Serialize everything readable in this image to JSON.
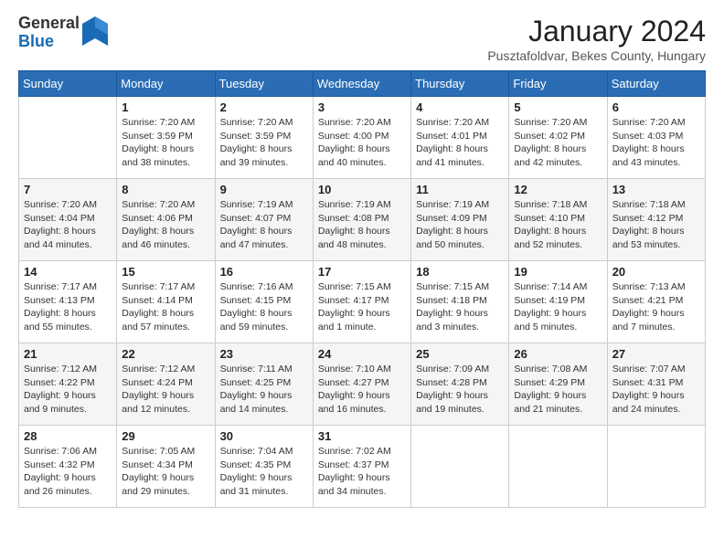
{
  "logo": {
    "general": "General",
    "blue": "Blue"
  },
  "title": "January 2024",
  "location": "Pusztafoldvar, Bekes County, Hungary",
  "weekdays": [
    "Sunday",
    "Monday",
    "Tuesday",
    "Wednesday",
    "Thursday",
    "Friday",
    "Saturday"
  ],
  "weeks": [
    [
      {
        "day": "",
        "sunrise": "",
        "sunset": "",
        "daylight": ""
      },
      {
        "day": "1",
        "sunrise": "Sunrise: 7:20 AM",
        "sunset": "Sunset: 3:59 PM",
        "daylight": "Daylight: 8 hours and 38 minutes."
      },
      {
        "day": "2",
        "sunrise": "Sunrise: 7:20 AM",
        "sunset": "Sunset: 3:59 PM",
        "daylight": "Daylight: 8 hours and 39 minutes."
      },
      {
        "day": "3",
        "sunrise": "Sunrise: 7:20 AM",
        "sunset": "Sunset: 4:00 PM",
        "daylight": "Daylight: 8 hours and 40 minutes."
      },
      {
        "day": "4",
        "sunrise": "Sunrise: 7:20 AM",
        "sunset": "Sunset: 4:01 PM",
        "daylight": "Daylight: 8 hours and 41 minutes."
      },
      {
        "day": "5",
        "sunrise": "Sunrise: 7:20 AM",
        "sunset": "Sunset: 4:02 PM",
        "daylight": "Daylight: 8 hours and 42 minutes."
      },
      {
        "day": "6",
        "sunrise": "Sunrise: 7:20 AM",
        "sunset": "Sunset: 4:03 PM",
        "daylight": "Daylight: 8 hours and 43 minutes."
      }
    ],
    [
      {
        "day": "7",
        "sunrise": "Sunrise: 7:20 AM",
        "sunset": "Sunset: 4:04 PM",
        "daylight": "Daylight: 8 hours and 44 minutes."
      },
      {
        "day": "8",
        "sunrise": "Sunrise: 7:20 AM",
        "sunset": "Sunset: 4:06 PM",
        "daylight": "Daylight: 8 hours and 46 minutes."
      },
      {
        "day": "9",
        "sunrise": "Sunrise: 7:19 AM",
        "sunset": "Sunset: 4:07 PM",
        "daylight": "Daylight: 8 hours and 47 minutes."
      },
      {
        "day": "10",
        "sunrise": "Sunrise: 7:19 AM",
        "sunset": "Sunset: 4:08 PM",
        "daylight": "Daylight: 8 hours and 48 minutes."
      },
      {
        "day": "11",
        "sunrise": "Sunrise: 7:19 AM",
        "sunset": "Sunset: 4:09 PM",
        "daylight": "Daylight: 8 hours and 50 minutes."
      },
      {
        "day": "12",
        "sunrise": "Sunrise: 7:18 AM",
        "sunset": "Sunset: 4:10 PM",
        "daylight": "Daylight: 8 hours and 52 minutes."
      },
      {
        "day": "13",
        "sunrise": "Sunrise: 7:18 AM",
        "sunset": "Sunset: 4:12 PM",
        "daylight": "Daylight: 8 hours and 53 minutes."
      }
    ],
    [
      {
        "day": "14",
        "sunrise": "Sunrise: 7:17 AM",
        "sunset": "Sunset: 4:13 PM",
        "daylight": "Daylight: 8 hours and 55 minutes."
      },
      {
        "day": "15",
        "sunrise": "Sunrise: 7:17 AM",
        "sunset": "Sunset: 4:14 PM",
        "daylight": "Daylight: 8 hours and 57 minutes."
      },
      {
        "day": "16",
        "sunrise": "Sunrise: 7:16 AM",
        "sunset": "Sunset: 4:15 PM",
        "daylight": "Daylight: 8 hours and 59 minutes."
      },
      {
        "day": "17",
        "sunrise": "Sunrise: 7:15 AM",
        "sunset": "Sunset: 4:17 PM",
        "daylight": "Daylight: 9 hours and 1 minute."
      },
      {
        "day": "18",
        "sunrise": "Sunrise: 7:15 AM",
        "sunset": "Sunset: 4:18 PM",
        "daylight": "Daylight: 9 hours and 3 minutes."
      },
      {
        "day": "19",
        "sunrise": "Sunrise: 7:14 AM",
        "sunset": "Sunset: 4:19 PM",
        "daylight": "Daylight: 9 hours and 5 minutes."
      },
      {
        "day": "20",
        "sunrise": "Sunrise: 7:13 AM",
        "sunset": "Sunset: 4:21 PM",
        "daylight": "Daylight: 9 hours and 7 minutes."
      }
    ],
    [
      {
        "day": "21",
        "sunrise": "Sunrise: 7:12 AM",
        "sunset": "Sunset: 4:22 PM",
        "daylight": "Daylight: 9 hours and 9 minutes."
      },
      {
        "day": "22",
        "sunrise": "Sunrise: 7:12 AM",
        "sunset": "Sunset: 4:24 PM",
        "daylight": "Daylight: 9 hours and 12 minutes."
      },
      {
        "day": "23",
        "sunrise": "Sunrise: 7:11 AM",
        "sunset": "Sunset: 4:25 PM",
        "daylight": "Daylight: 9 hours and 14 minutes."
      },
      {
        "day": "24",
        "sunrise": "Sunrise: 7:10 AM",
        "sunset": "Sunset: 4:27 PM",
        "daylight": "Daylight: 9 hours and 16 minutes."
      },
      {
        "day": "25",
        "sunrise": "Sunrise: 7:09 AM",
        "sunset": "Sunset: 4:28 PM",
        "daylight": "Daylight: 9 hours and 19 minutes."
      },
      {
        "day": "26",
        "sunrise": "Sunrise: 7:08 AM",
        "sunset": "Sunset: 4:29 PM",
        "daylight": "Daylight: 9 hours and 21 minutes."
      },
      {
        "day": "27",
        "sunrise": "Sunrise: 7:07 AM",
        "sunset": "Sunset: 4:31 PM",
        "daylight": "Daylight: 9 hours and 24 minutes."
      }
    ],
    [
      {
        "day": "28",
        "sunrise": "Sunrise: 7:06 AM",
        "sunset": "Sunset: 4:32 PM",
        "daylight": "Daylight: 9 hours and 26 minutes."
      },
      {
        "day": "29",
        "sunrise": "Sunrise: 7:05 AM",
        "sunset": "Sunset: 4:34 PM",
        "daylight": "Daylight: 9 hours and 29 minutes."
      },
      {
        "day": "30",
        "sunrise": "Sunrise: 7:04 AM",
        "sunset": "Sunset: 4:35 PM",
        "daylight": "Daylight: 9 hours and 31 minutes."
      },
      {
        "day": "31",
        "sunrise": "Sunrise: 7:02 AM",
        "sunset": "Sunset: 4:37 PM",
        "daylight": "Daylight: 9 hours and 34 minutes."
      },
      {
        "day": "",
        "sunrise": "",
        "sunset": "",
        "daylight": ""
      },
      {
        "day": "",
        "sunrise": "",
        "sunset": "",
        "daylight": ""
      },
      {
        "day": "",
        "sunrise": "",
        "sunset": "",
        "daylight": ""
      }
    ]
  ]
}
